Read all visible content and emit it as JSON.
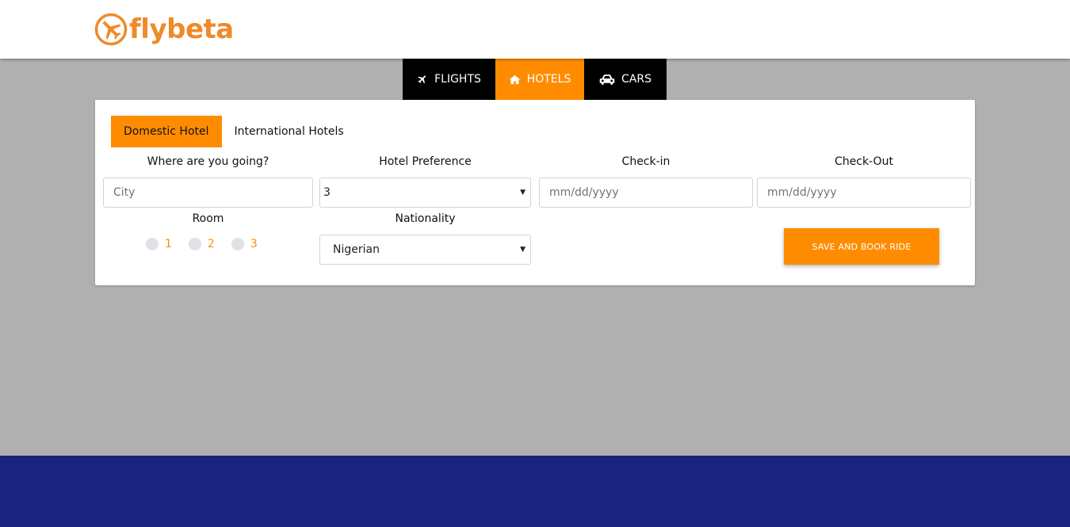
{
  "brand": {
    "name": "flybeta",
    "color": "#ef8a2b"
  },
  "product_tabs": [
    {
      "label": "FLIGHTS",
      "icon": "plane-icon",
      "active": false
    },
    {
      "label": "HOTELS",
      "icon": "home-icon",
      "active": true
    },
    {
      "label": "CARS",
      "icon": "car-icon",
      "active": false
    }
  ],
  "sub_tabs": [
    {
      "label": "Domestic Hotel",
      "active": true
    },
    {
      "label": "International Hotels",
      "active": false
    }
  ],
  "form": {
    "destination_label": "Where are you going?",
    "destination_placeholder": "City",
    "hotel_pref_label": "Hotel Preference",
    "hotel_pref_value": "3",
    "checkin_label": "Check-in",
    "checkin_placeholder": "mm/dd/yyyy",
    "checkout_label": "Check-Out",
    "checkout_placeholder": "mm/dd/yyyy",
    "room_label": "Room",
    "room_options": [
      "1",
      "2",
      "3"
    ],
    "nationality_label": "Nationality",
    "nationality_value": "Nigerian",
    "submit_label": "SAVE AND BOOK RIDE"
  },
  "colors": {
    "accent": "#ff8c00",
    "footer": "#1a237e",
    "background": "#b0b0b0"
  }
}
